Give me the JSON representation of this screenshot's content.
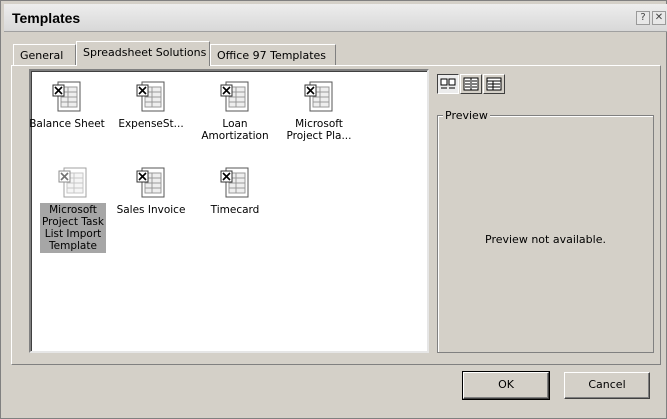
{
  "window": {
    "title": "Templates",
    "help_glyph": "?",
    "close_glyph": "✕"
  },
  "tabs": [
    {
      "label": "General",
      "active": false
    },
    {
      "label": "Spreadsheet Solutions",
      "active": true
    },
    {
      "label": "Office 97 Templates",
      "active": false
    }
  ],
  "templates": [
    {
      "label": "Balance Sheet",
      "selected": false
    },
    {
      "label": "ExpenseSt...",
      "selected": false
    },
    {
      "label": "Loan\nAmortization",
      "selected": false
    },
    {
      "label": "Microsoft\nProject Pla...",
      "selected": false
    },
    {
      "label": "Microsoft\nProject Task\nList Import\nTemplate",
      "selected": true
    },
    {
      "label": "Sales Invoice",
      "selected": false
    },
    {
      "label": "Timecard",
      "selected": false
    }
  ],
  "view_buttons": [
    {
      "name": "large-icons",
      "pressed": true
    },
    {
      "name": "list",
      "pressed": false
    },
    {
      "name": "details",
      "pressed": false
    }
  ],
  "preview": {
    "legend": "Preview",
    "message": "Preview not available."
  },
  "buttons": {
    "ok": "OK",
    "cancel": "Cancel"
  }
}
